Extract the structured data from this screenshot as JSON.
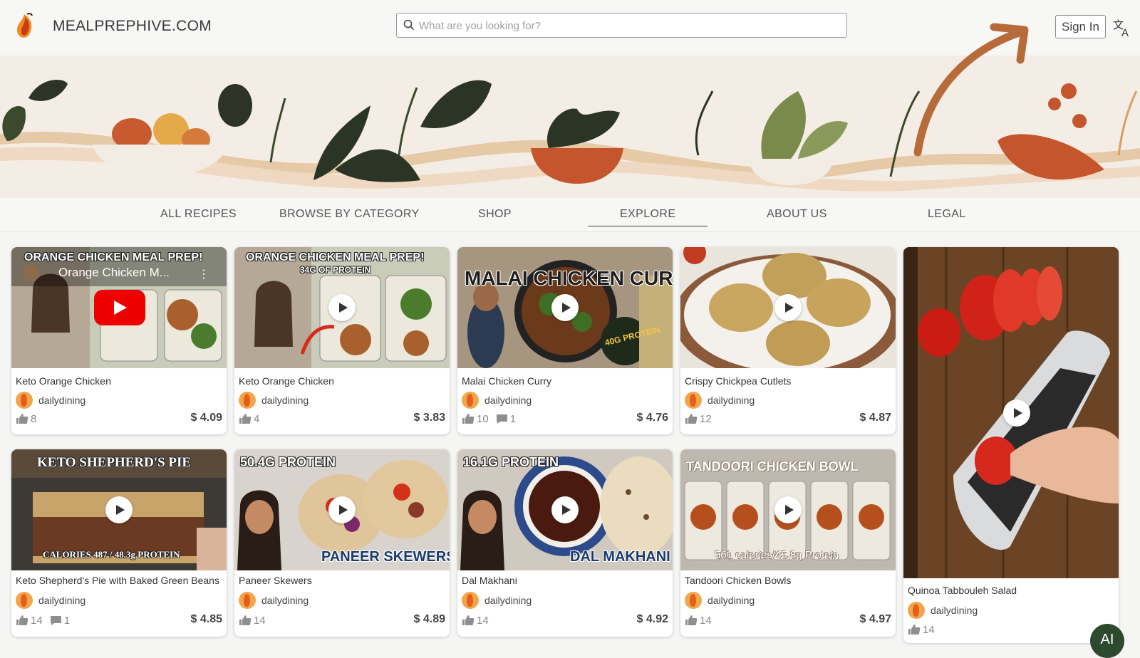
{
  "header": {
    "site_name": "MEALPREPHIVE.COM",
    "search_placeholder": "What are you looking for?",
    "signin_label": "Sign In"
  },
  "nav": {
    "items": [
      "ALL RECIPES",
      "BROWSE BY CATEGORY",
      "SHOP",
      "EXPLORE",
      "ABOUT US",
      "LEGAL"
    ],
    "active": "EXPLORE"
  },
  "cards": [
    {
      "title": "Keto Orange Chicken",
      "author": "dailydining",
      "likes": "8",
      "comments": "",
      "price": "$ 4.09",
      "thumb_text": "ORANGE CHICKEN MEAL PREP!",
      "thumb_sub": "Orange Chicken M...",
      "video_player": "youtube"
    },
    {
      "title": "Keto Orange Chicken",
      "author": "dailydining",
      "likes": "4",
      "comments": "",
      "price": "$ 3.83",
      "thumb_text": "ORANGE CHICKEN MEAL PREP!",
      "thumb_sub": "34G OF PROTEIN"
    },
    {
      "title": "Malai Chicken Curry",
      "author": "dailydining",
      "likes": "10",
      "comments": "1",
      "price": "$ 4.76",
      "thumb_text": "MALAI CHICKEN CURRY",
      "thumb_sub": "40G PROTEIN"
    },
    {
      "title": "Crispy Chickpea Cutlets",
      "author": "dailydining",
      "likes": "12",
      "comments": "",
      "price": "$ 4.87"
    },
    {
      "title": "Quinoa Tabbouleh Salad",
      "author": "dailydining",
      "likes": "14",
      "comments": "",
      "price": ""
    },
    {
      "title": "Keto Shepherd's Pie with Baked Green Beans",
      "author": "dailydining",
      "likes": "14",
      "comments": "1",
      "price": "$ 4.85",
      "thumb_text": "KETO SHEPHERD'S PIE",
      "thumb_sub": "CALORIES 487 / 48.3g PROTEIN"
    },
    {
      "title": "Paneer Skewers",
      "author": "dailydining",
      "likes": "14",
      "comments": "",
      "price": "$ 4.89",
      "thumb_text": "50.4G PROTEIN",
      "thumb_sub": "PANEER SKEWERS"
    },
    {
      "title": "Dal Makhani",
      "author": "dailydining",
      "likes": "14",
      "comments": "",
      "price": "$ 4.92",
      "thumb_text": "16.1G PROTEIN",
      "thumb_sub": "DAL MAKHANI"
    },
    {
      "title": "Tandoori Chicken Bowls",
      "author": "dailydining",
      "likes": "14",
      "comments": "",
      "price": "$ 4.97",
      "thumb_text": "TANDOORI CHICKEN BOWL",
      "thumb_sub": "561 calories/45.8g Protein"
    }
  ],
  "ai_badge": "AI",
  "colors": {
    "accent_arrow": "#b86b3a",
    "nav_text": "#555555",
    "avatar": "#f0a64a"
  }
}
